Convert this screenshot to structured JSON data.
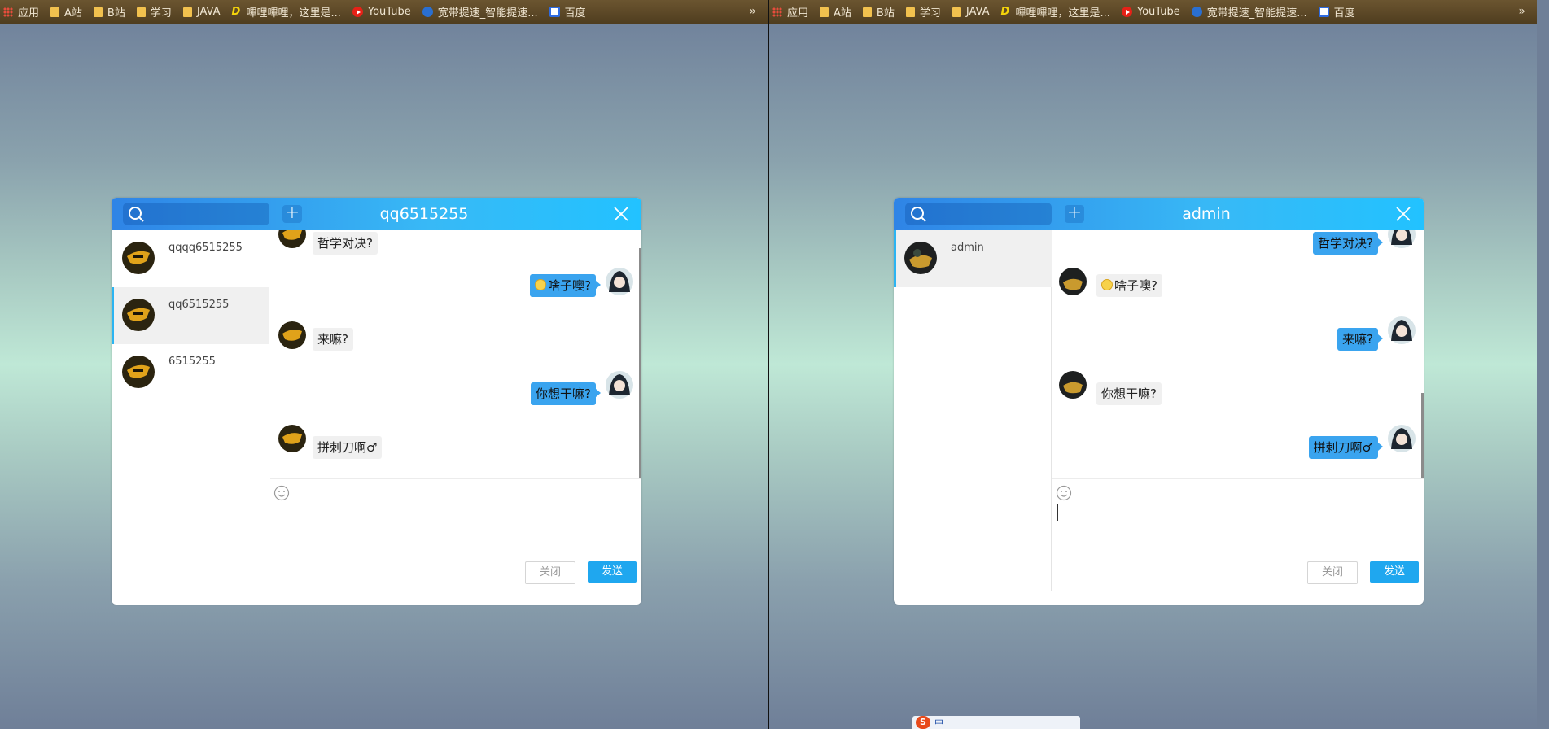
{
  "bookmarks": [
    {
      "label": "应用",
      "icon": "apps-grid-icon"
    },
    {
      "label": "A站",
      "icon": "folder-icon"
    },
    {
      "label": "B站",
      "icon": "folder-icon"
    },
    {
      "label": "学习",
      "icon": "folder-icon"
    },
    {
      "label": "JAVA",
      "icon": "folder-icon"
    },
    {
      "label": "嗶哩嗶哩，这里是...",
      "icon": "bilibili-icon"
    },
    {
      "label": "YouTube",
      "icon": "youtube-icon"
    },
    {
      "label": "宽带提速_智能提速...",
      "icon": "telecom-icon"
    },
    {
      "label": "百度",
      "icon": "baidu-icon"
    }
  ],
  "bookmarks_more": "»",
  "left": {
    "title": "qq6515255",
    "contacts": [
      {
        "name": "qqqq6515255",
        "active": false
      },
      {
        "name": "qq6515255",
        "active": true
      },
      {
        "name": "6515255",
        "active": false
      }
    ],
    "messages": [
      {
        "side": "in",
        "text": "哲学对决?"
      },
      {
        "side": "out",
        "text": "啥子噢?",
        "emoji": true
      },
      {
        "side": "in",
        "text": "来嘛?"
      },
      {
        "side": "out",
        "text": "你想干嘛?"
      },
      {
        "side": "in",
        "text": "拼刺刀啊♂"
      }
    ],
    "close_label": "关闭",
    "send_label": "发送"
  },
  "right": {
    "title": "admin",
    "contacts": [
      {
        "name": "admin",
        "active": true
      }
    ],
    "messages": [
      {
        "side": "out",
        "text": "哲学对决?"
      },
      {
        "side": "in",
        "text": "啥子噢?",
        "emoji": true
      },
      {
        "side": "out",
        "text": "来嘛?"
      },
      {
        "side": "in",
        "text": "你想干嘛?"
      },
      {
        "side": "out",
        "text": "拼刺刀啊♂"
      }
    ],
    "close_label": "关闭",
    "send_label": "发送"
  },
  "ime": {
    "label": "中"
  },
  "colors": {
    "header_start": "#2f84e6",
    "header_end": "#22c2ff",
    "send_button": "#1fa7ef",
    "out_bubble": "#3aa4ef"
  }
}
